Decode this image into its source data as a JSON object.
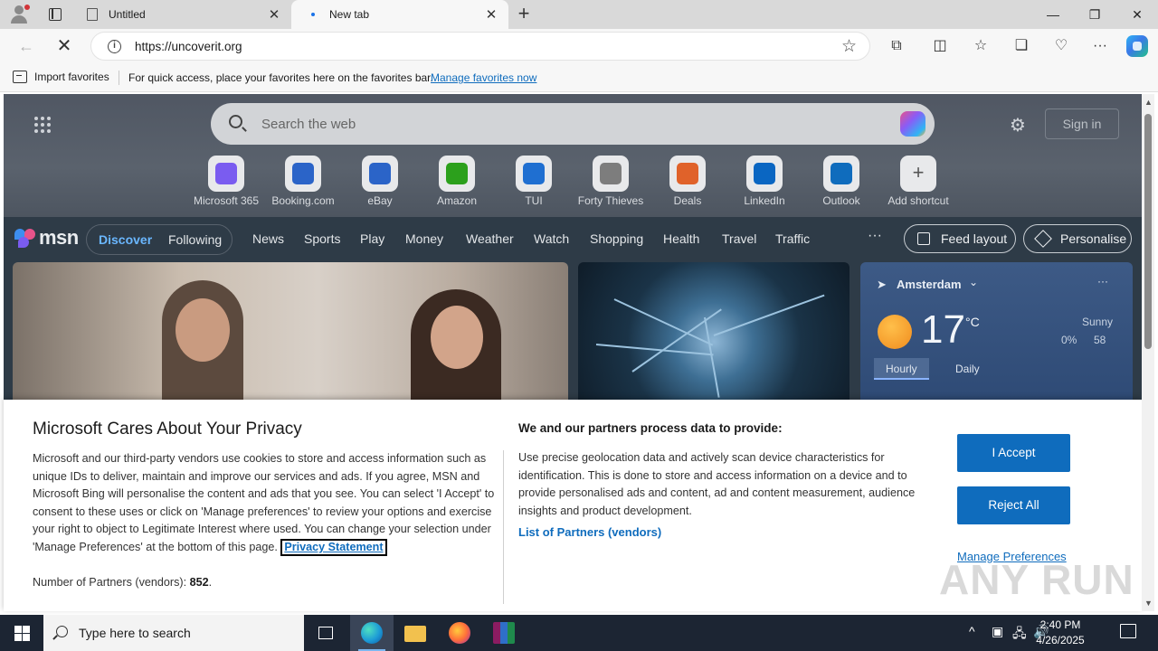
{
  "browser": {
    "tabs": [
      {
        "title": "Untitled",
        "close": "✕"
      },
      {
        "title": "New tab",
        "close": "✕"
      }
    ],
    "new_tab_glyph": "+",
    "window_controls": {
      "minimize": "—",
      "maximize": "❐",
      "close": "✕"
    },
    "url": "https://uncoverit.org",
    "favorites_bar": {
      "import_label": "Import favorites",
      "message": "For quick access, place your favorites here on the favorites bar.",
      "link": "Manage favorites now"
    }
  },
  "msn": {
    "search_placeholder": "Search the web",
    "sign_in": "Sign in",
    "shortcuts": [
      {
        "label": "Microsoft 365",
        "color": "#7a5cf0"
      },
      {
        "label": "Booking.com",
        "color": "#2b64c8"
      },
      {
        "label": "eBay",
        "color": "#2b64c8"
      },
      {
        "label": "Amazon",
        "color": "#2ca01c"
      },
      {
        "label": "TUI",
        "color": "#1f6fd1"
      },
      {
        "label": "Forty Thieves",
        "color": "#7d7d7d"
      },
      {
        "label": "Deals",
        "color": "#e0622a"
      },
      {
        "label": "LinkedIn",
        "color": "#0a66c2"
      },
      {
        "label": "Outlook",
        "color": "#0f6cbd"
      },
      {
        "label": "Add shortcut",
        "color": "#7d7d7d"
      }
    ],
    "logo": "msn",
    "nav_pill": {
      "discover": "Discover",
      "following": "Following"
    },
    "nav_links": [
      "News",
      "Sports",
      "Play",
      "Money",
      "Weather",
      "Watch",
      "Shopping",
      "Health",
      "Travel",
      "Traffic"
    ],
    "more": "···",
    "feed_layout": "Feed layout",
    "personalise": "Personalise",
    "weather": {
      "location": "Amsterdam",
      "temperature": "17",
      "unit": "°C",
      "condition": "Sunny",
      "precipitation": "0%",
      "aqi": "58",
      "tabs": [
        "Hourly",
        "Daily"
      ]
    }
  },
  "consent": {
    "title": "Microsoft Cares About Your Privacy",
    "body": "Microsoft and our third-party vendors use cookies to store and access information such as unique IDs to deliver, maintain and improve our services and ads. If you agree, MSN and Microsoft Bing will personalise the content and ads that you see. You can select 'I Accept' to consent to these uses or click on 'Manage preferences' to review your options and exercise your right to object to Legitimate Interest where used. You can change your selection under 'Manage Preferences' at the bottom of this page.",
    "privacy_link": "Privacy Statement",
    "partners_label": "Number of Partners (vendors):",
    "partners_count": "852",
    "partners_suffix": ".",
    "purposes_title": "We and our partners process data to provide:",
    "purposes_body": "Use precise geolocation data and actively scan device characteristics for identification. This is done to store and access information on a device and to provide personalised ads and content, ad and content measurement, audience insights and product development.",
    "list_partners": "List of Partners (vendors)",
    "accept": "I Accept",
    "reject": "Reject All",
    "manage": "Manage Preferences"
  },
  "watermark": "ANY RUN",
  "taskbar": {
    "search_placeholder": "Type here to search",
    "time": "2:40 PM",
    "date": "4/26/2025"
  }
}
